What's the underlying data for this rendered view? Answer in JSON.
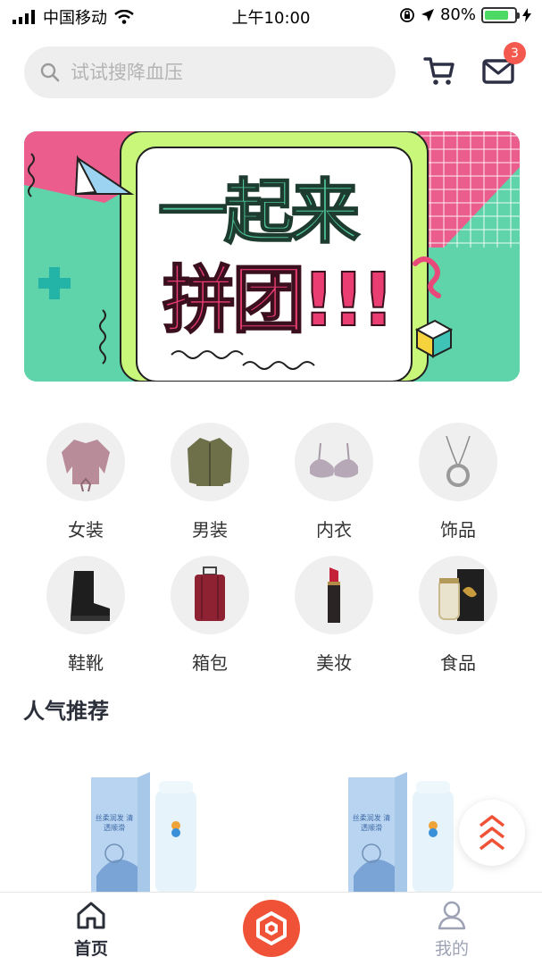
{
  "status_bar": {
    "carrier": "中国移动",
    "time": "上午10:00",
    "battery": "80%",
    "battery_level": 0.8
  },
  "header": {
    "search_placeholder": "试试搜降血压",
    "cart_icon": "cart-icon",
    "mail_icon": "mail-icon",
    "mail_badge": "3"
  },
  "banner": {
    "line1": "一起来",
    "line2": "拼团!!!"
  },
  "categories": [
    {
      "label": "女装",
      "icon": "womens-top-icon"
    },
    {
      "label": "男装",
      "icon": "mens-jacket-icon"
    },
    {
      "label": "内衣",
      "icon": "bra-icon"
    },
    {
      "label": "饰品",
      "icon": "necklace-icon"
    },
    {
      "label": "鞋靴",
      "icon": "boot-icon"
    },
    {
      "label": "箱包",
      "icon": "suitcase-icon"
    },
    {
      "label": "美妆",
      "icon": "lipstick-icon"
    },
    {
      "label": "食品",
      "icon": "food-box-icon"
    }
  ],
  "section": {
    "title": "人气推荐"
  },
  "products": [
    {
      "box_text": "丝柔润发 清透顺滑",
      "image": "shampoo-product"
    },
    {
      "box_text": "丝柔润发 清透顺滑",
      "image": "shampoo-product"
    }
  ],
  "tab_bar": {
    "tabs": [
      {
        "label": "首页",
        "icon": "home-icon",
        "active": true
      },
      {
        "label": "我的",
        "icon": "profile-icon",
        "active": false
      }
    ],
    "center_icon": "hexagon-logo-icon"
  },
  "colors": {
    "accent": "#ef5236",
    "badge": "#f4594f",
    "banner_green": "#5fd3a9",
    "banner_pink": "#ea5d8c",
    "banner_lime": "#c9f77a"
  }
}
